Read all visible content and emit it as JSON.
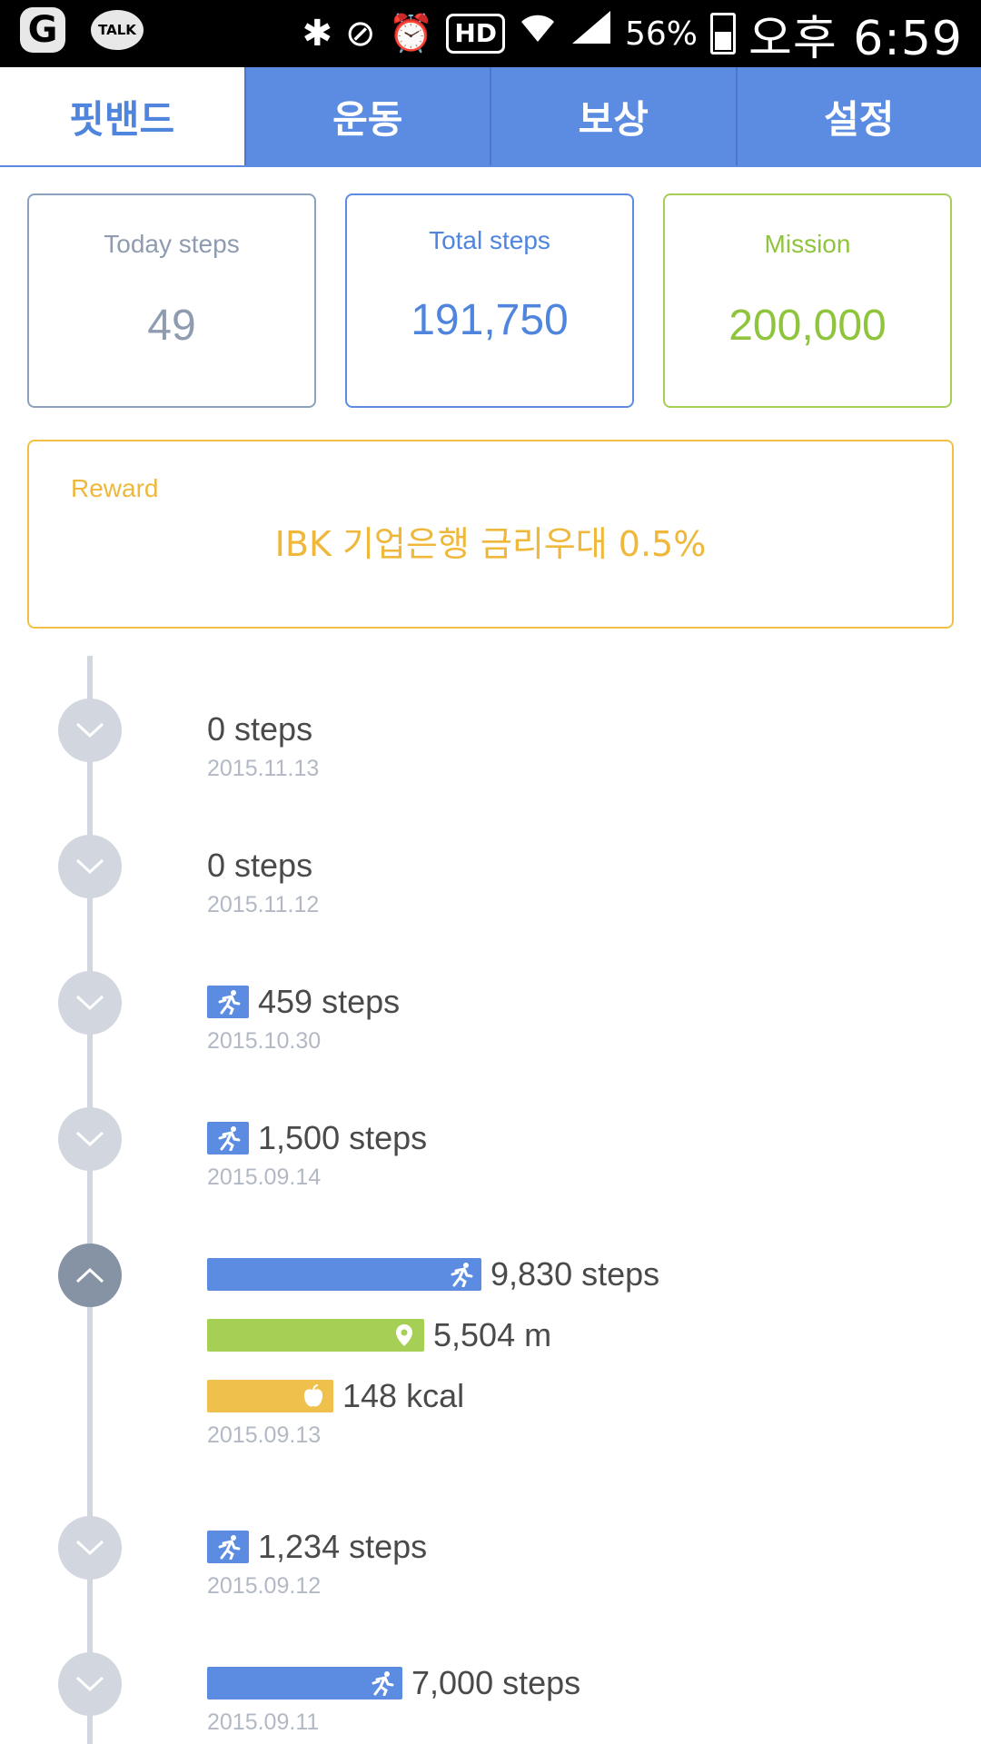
{
  "status_bar": {
    "app_g": "G",
    "talk": "TALK",
    "battery_pct": "56%",
    "time": "오후 6:59",
    "hd": "HD"
  },
  "tabs": [
    {
      "label": "핏밴드",
      "active": true
    },
    {
      "label": "운동",
      "active": false
    },
    {
      "label": "보상",
      "active": false
    },
    {
      "label": "설정",
      "active": false
    }
  ],
  "stats": {
    "today": {
      "label": "Today steps",
      "value": "49"
    },
    "total": {
      "label": "Total steps",
      "value": "191,750"
    },
    "mission": {
      "label": "Mission",
      "value": "200,000"
    }
  },
  "reward": {
    "label": "Reward",
    "text": "IBK 기업은행 금리우대 0.5%"
  },
  "timeline": [
    {
      "steps": "0 steps",
      "date": "2015.11.13",
      "steps_fraction": 0
    },
    {
      "steps": "0 steps",
      "date": "2015.11.12",
      "steps_fraction": 0
    },
    {
      "steps": "459 steps",
      "date": "2015.10.30",
      "steps_fraction": 0.047
    },
    {
      "steps": "1,500 steps",
      "date": "2015.09.14",
      "steps_fraction": 0.153
    },
    {
      "steps": "9,830 steps",
      "distance": "5,504 m",
      "calories": "148 kcal",
      "date": "2015.09.13",
      "expanded": true,
      "steps_fraction": 1.0,
      "distance_fraction": 0.56,
      "calories_fraction": 0.015
    },
    {
      "steps": "1,234 steps",
      "date": "2015.09.12",
      "steps_fraction": 0.126
    },
    {
      "steps": "7,000 steps",
      "date": "2015.09.11",
      "steps_fraction": 0.712
    }
  ],
  "colors": {
    "primary": "#5b8ce1",
    "green": "#a6cf55",
    "yellow": "#efc04b",
    "gray_line": "#d2d7df"
  }
}
